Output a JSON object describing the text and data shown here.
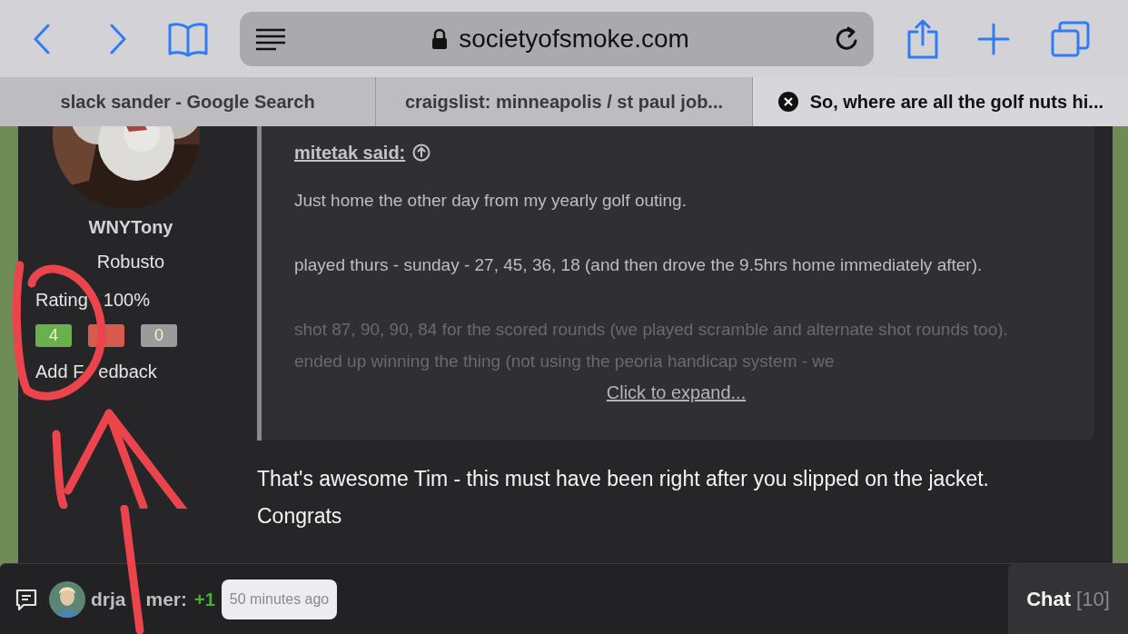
{
  "browser": {
    "url": "societyofsmoke.com",
    "tabs": [
      {
        "title": "slack sander - Google Search",
        "selected": false
      },
      {
        "title": "craigslist: minneapolis / st paul job...",
        "selected": false
      },
      {
        "title": "So, where are all the golf nuts hi...",
        "selected": true
      }
    ]
  },
  "user": {
    "name": "WNYTony",
    "rank": "Robusto",
    "rating_parts": [
      "Rating",
      "100%"
    ],
    "feedback": [
      {
        "count": "4",
        "color": "#6ab04c"
      },
      {
        "color": "#d55b4f"
      },
      {
        "count": "0",
        "color": "#9b9b9b"
      }
    ],
    "add_feedback_parts": [
      "Add F",
      "edback"
    ]
  },
  "quote": {
    "author": "mitetak said:",
    "paragraphs": [
      "Just home the other day from my yearly golf outing.",
      "played thurs - sunday - 27, 45, 36, 18 (and then drove the 9.5hrs home immediately after).",
      "shot 87, 90, 90, 84 for the scored rounds (we played scramble and alternate shot rounds too). ended up winning the thing (not using the peoria handicap system - we"
    ],
    "expand": "Click to expand..."
  },
  "reply": "That's awesome Tim - this must have been right after you slipped on the jacket. Congrats",
  "chat_bar": {
    "user_parts": [
      "drja",
      "mer:"
    ],
    "score": "+1",
    "time": "50 minutes ago",
    "button": "Chat",
    "count": "[10]"
  }
}
